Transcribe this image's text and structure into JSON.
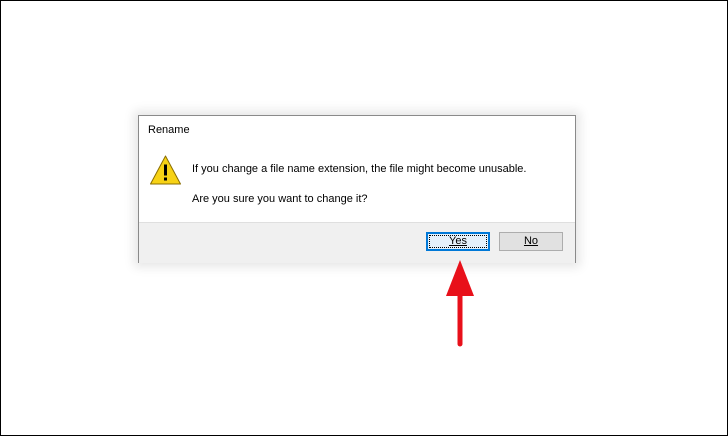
{
  "dialog": {
    "title": "Rename",
    "icon": "warning-icon",
    "message_line1": "If you change a file name extension, the file might become unusable.",
    "message_line2": "Are you sure you want to change it?",
    "buttons": {
      "yes_label": "Yes",
      "no_label": "No"
    }
  },
  "annotation": {
    "icon": "red-arrow-pointing-up",
    "color": "#e8101a"
  },
  "colors": {
    "warning_fill": "#f7d215",
    "focus_border": "#0078d7",
    "button_bar": "#f0f0f0"
  }
}
